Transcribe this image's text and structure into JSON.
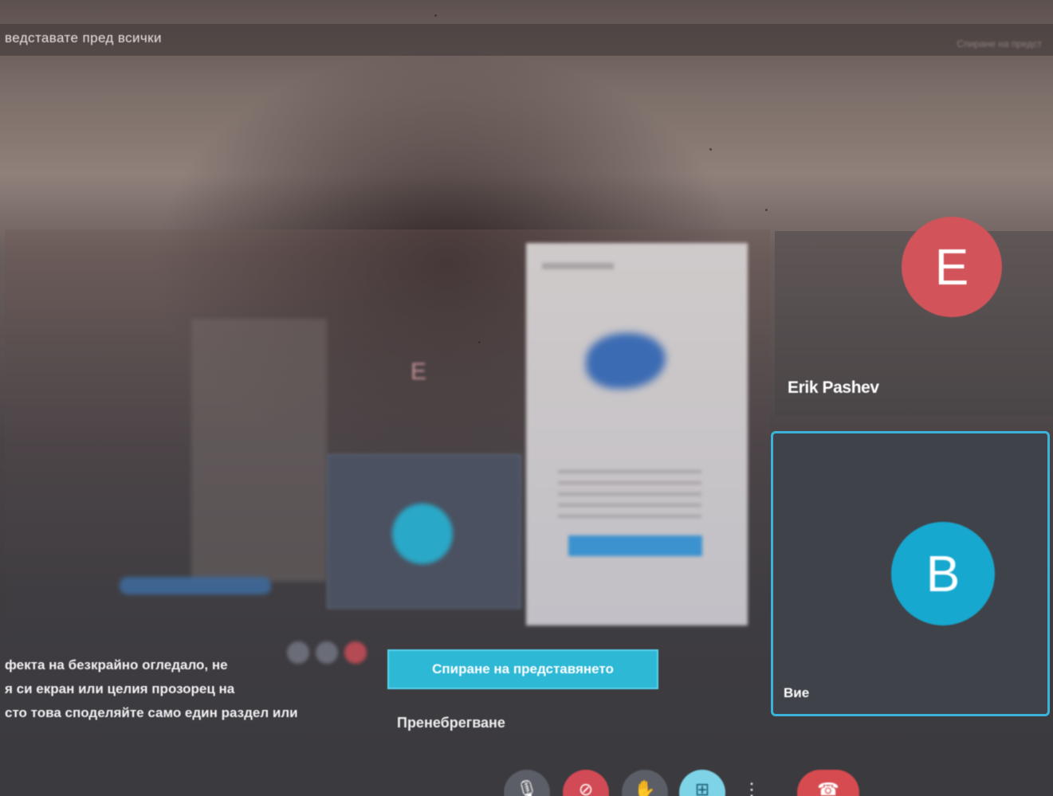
{
  "banner": {
    "presenting_text": "ведставате пред всички",
    "stop_presenting_top": "Спиране на предст"
  },
  "presentation": {
    "mirror_avatar_letter": "E"
  },
  "participants": [
    {
      "initial": "E",
      "name": "Erik Pashev",
      "avatar_color": "#d2545a"
    },
    {
      "initial": "B",
      "name": "Вие",
      "avatar_color": "#17a8cf",
      "highlighted": true
    }
  ],
  "warning": {
    "lines": [
      "фекта на безкрайно огледало, не",
      "я си екран или целия прозорец на",
      "сто това споделяйте само един раздел или"
    ]
  },
  "actions": {
    "stop_presenting_label": "Спиране на представянето",
    "ignore_label": "Пренебрегване"
  },
  "controls": {
    "mic_icon": "microphone-icon",
    "camera_icon": "camera-off-icon",
    "hand_icon": "raise-hand-icon",
    "present_icon": "present-screen-icon",
    "more_icon": "more-options-icon",
    "end_icon": "end-call-icon"
  },
  "colors": {
    "accent": "#2db8d6",
    "danger": "#d24a55"
  }
}
